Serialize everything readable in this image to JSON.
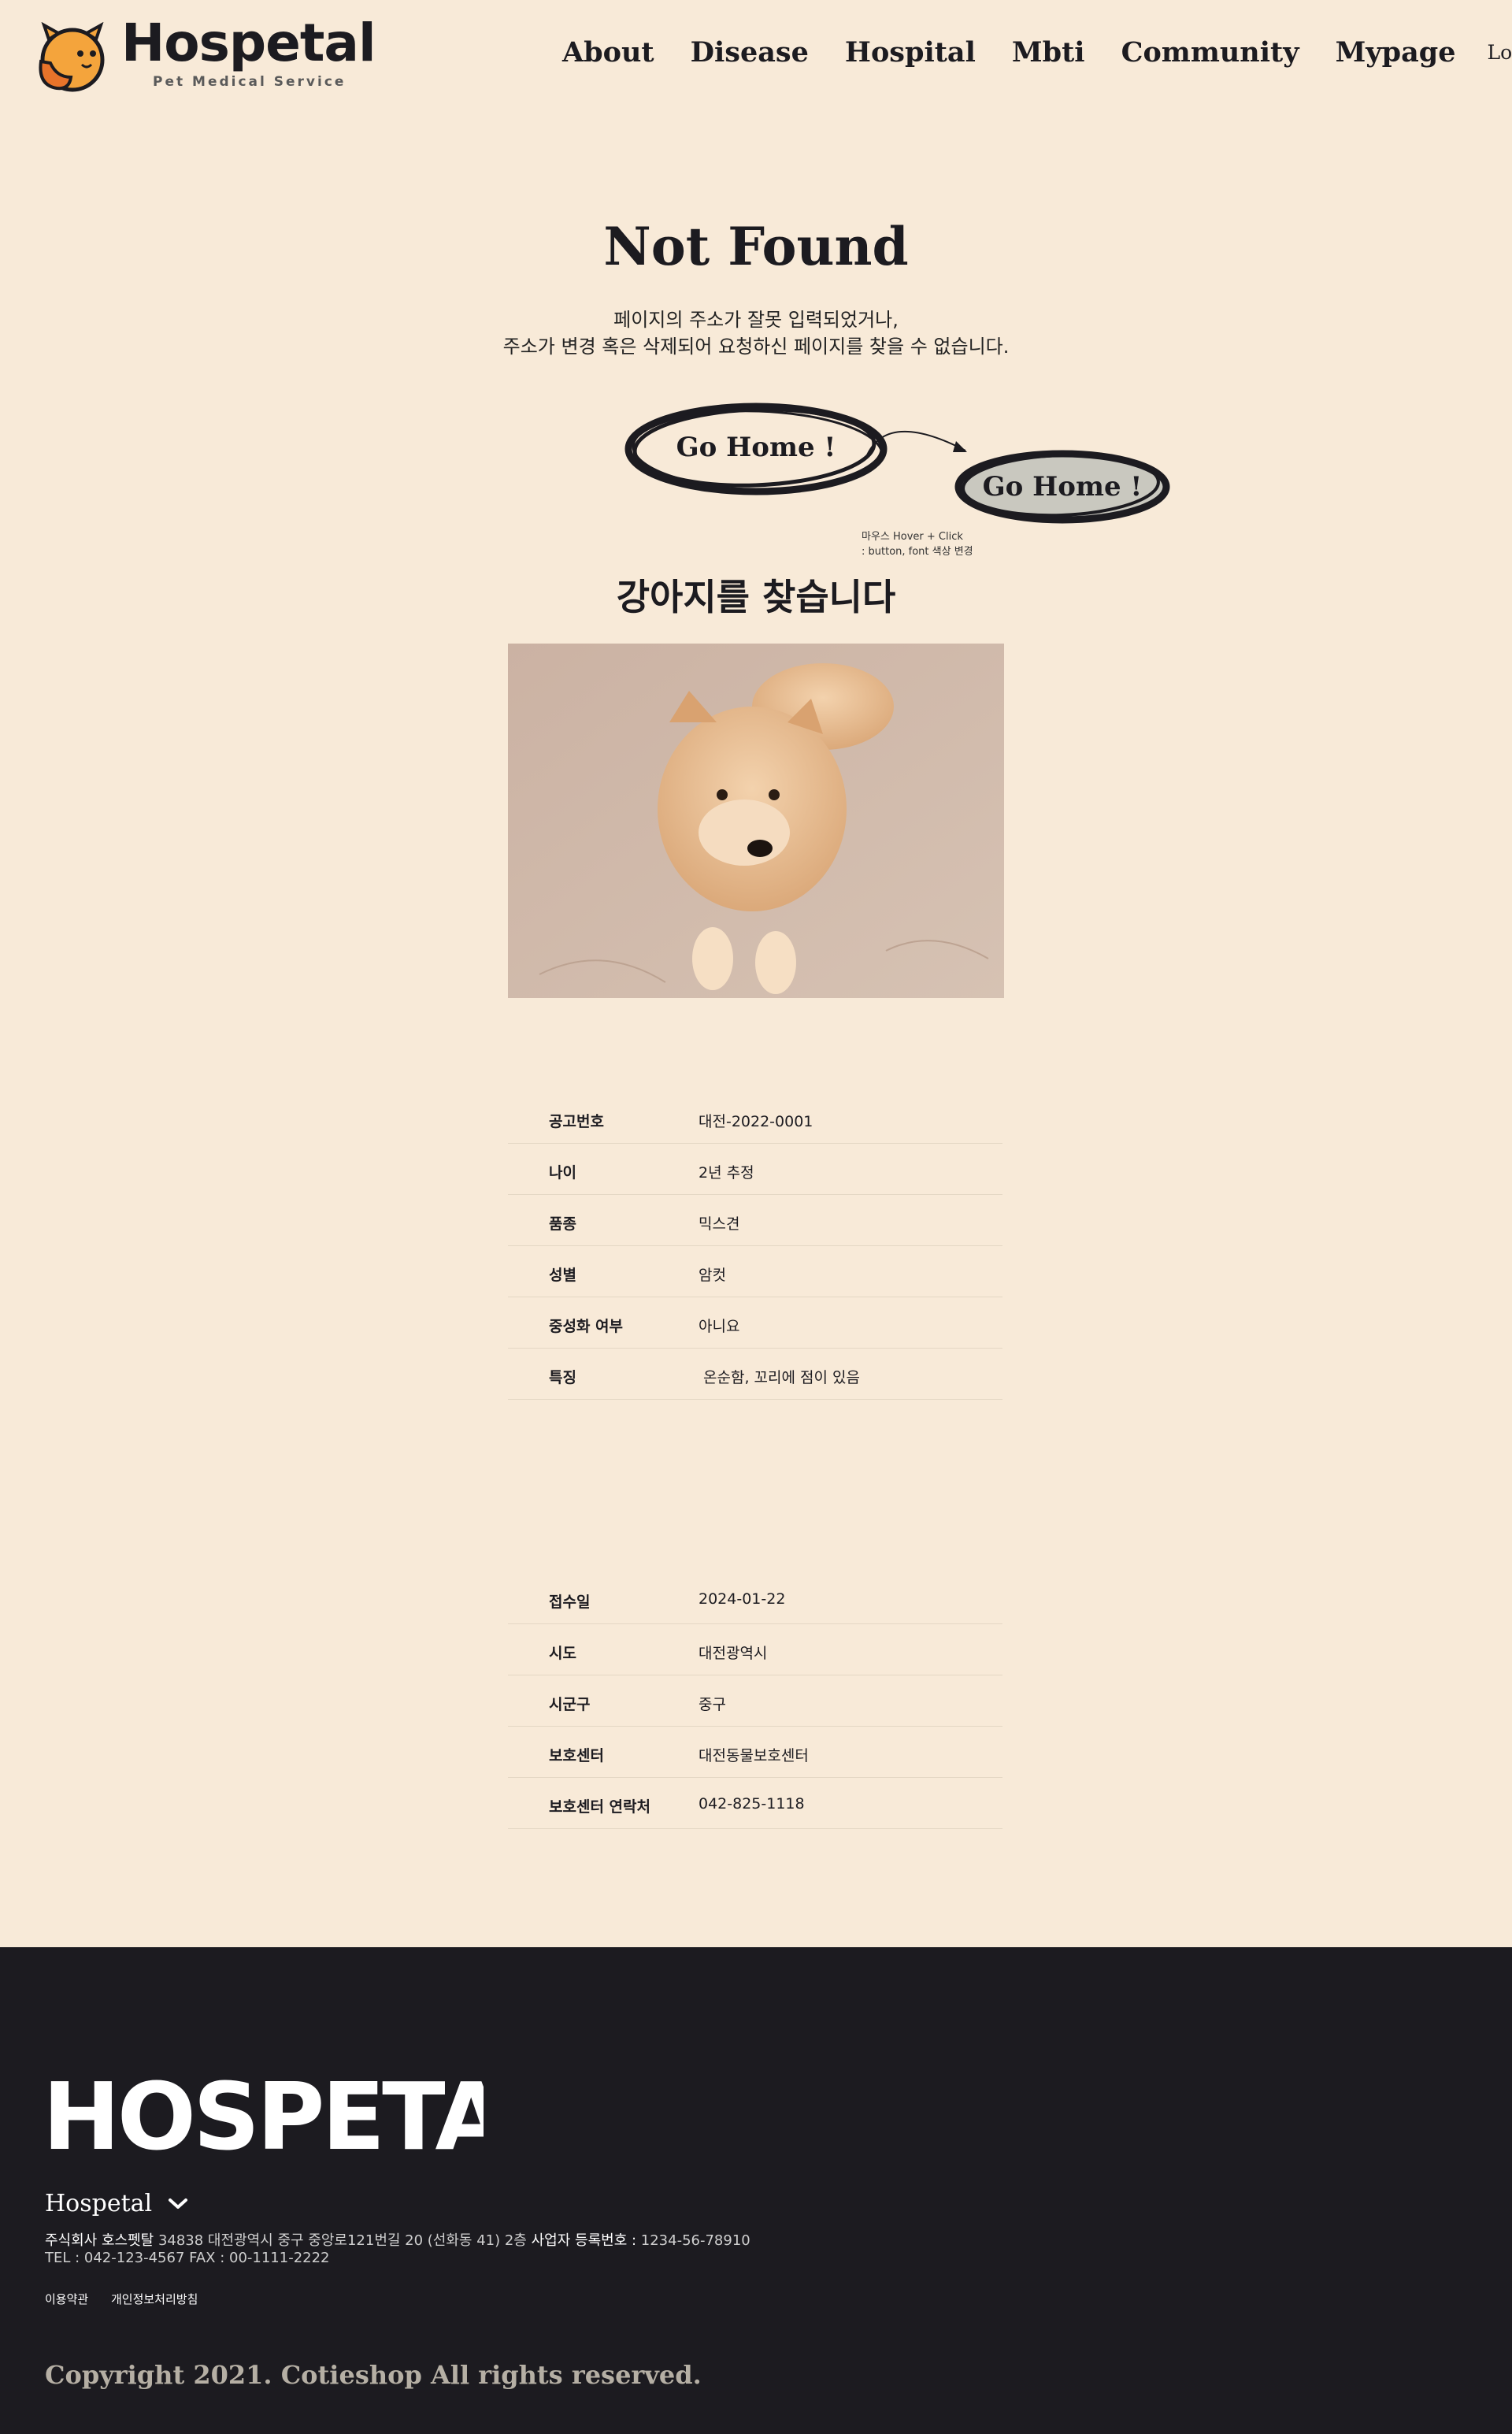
{
  "header": {
    "logo_text": "Hospetal",
    "logo_subtitle": "Pet Medical Service",
    "nav": [
      "About",
      "Disease",
      "Hospital",
      "Mbti",
      "Community",
      "Mypage"
    ],
    "login": "Login"
  },
  "main": {
    "title": "Not Found",
    "message_line1": "페이지의 주소가 잘못 입력되었거나,",
    "message_line2": "주소가 변경 혹은 삭제되어 요청하신 페이지를 찾을 수 없습니다.",
    "go_home_label": "Go Home !",
    "go_home_hover_label": "Go Home !",
    "hint_line1": "마우스 Hover + Click",
    "hint_line2": ": button, font 색상 변경",
    "lost_title": "강아지를 찾습니다",
    "table1": [
      {
        "label": "공고번호",
        "value": "대전-2022-0001"
      },
      {
        "label": "나이",
        "value": "2년 추정"
      },
      {
        "label": "품종",
        "value": "믹스견"
      },
      {
        "label": "성별",
        "value": "암컷"
      },
      {
        "label": "중성화 여부",
        "value": "아니요"
      },
      {
        "label": "특징",
        "value": " 온순함, 꼬리에 점이 있음"
      }
    ],
    "table2": [
      {
        "label": "접수일",
        "value": "2024-01-22"
      },
      {
        "label": "시도",
        "value": "대전광역시"
      },
      {
        "label": "시군구",
        "value": "중구"
      },
      {
        "label": "보호센터",
        "value": "대전동물보호센터"
      },
      {
        "label": "보호센터 연락처",
        "value": "042-825-1118"
      }
    ]
  },
  "footer": {
    "logo_text": "HOSPETAL",
    "brand": "Hospetal",
    "address_label": "주식회사 호스펫탈",
    "address": "34838 대전광역시 중구 중앙로121번길 20 (선화동 41) 2층",
    "biz_label": "사업자 등록번호 :",
    "biz_no": "1234-56-78910",
    "tel_fax": "TEL : 042-123-4567 FAX : 00-1111-2222",
    "links": [
      "이용약관",
      "개인정보처리방침"
    ],
    "copyright": "Copyright 2021. Cotieshop All rights reserved."
  },
  "colors": {
    "background": "#f8ead8",
    "footer_bg": "#1c1b20",
    "logo_orange": "#f4a43c",
    "hover_button_fill": "#c9c8bf"
  }
}
